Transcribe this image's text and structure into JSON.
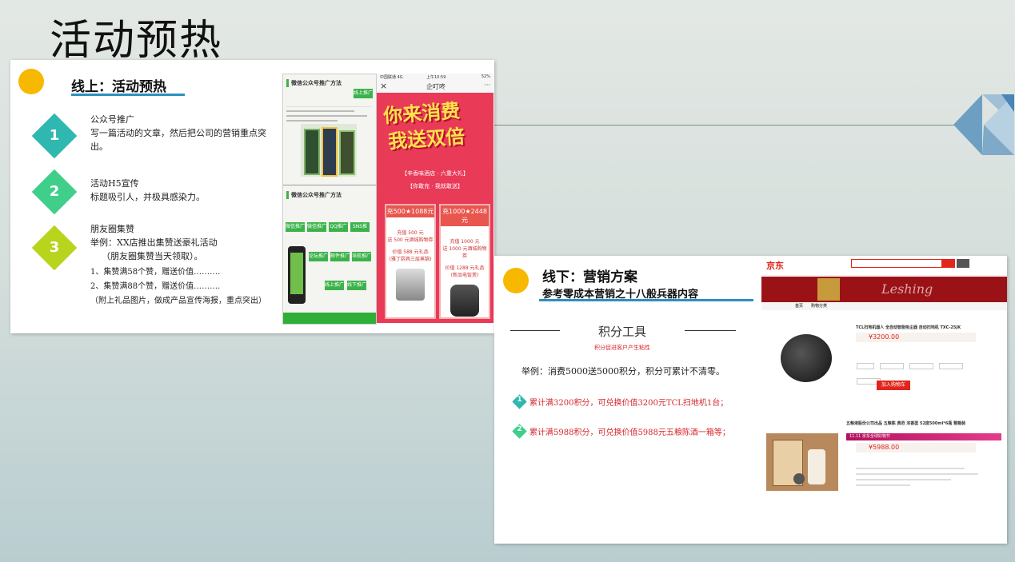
{
  "page": {
    "title": "活动预热"
  },
  "online": {
    "section_title": "线上：活动预热",
    "items": [
      {
        "num": "1",
        "title": "公众号推广",
        "desc": "写一篇活动的文章，然后把公司的营销重点突出。"
      },
      {
        "num": "2",
        "title": "活动H5宣传",
        "desc": "标题吸引人，并极具感染力。"
      },
      {
        "num": "3",
        "title": "朋友圈集赞",
        "desc": "举例：XX店推出集赞送豪礼活动",
        "desc2": "（朋友圈集赞当天领取）。",
        "sub": [
          "1、集赞满58个赞，赠送价值……….",
          "2、集赞满88个赞，赠送价值……….",
          "（附上礼品图片，做成产品宣传海报，重点突出）"
        ]
      }
    ],
    "wechat_shot": {
      "header1": "微信公众号推广方法",
      "tag1": "线上推广",
      "header2": "微信公众号推广方法",
      "buttons": [
        "微信推广",
        "微信推广",
        "QQ推广",
        "SNS推广",
        "论坛推广",
        "邮件推广",
        "导航推广"
      ],
      "tag_online": "线上推广",
      "tag_offline": "线下推广"
    },
    "h5_shot": {
      "status": "中国联通 4G",
      "time": "上午10:59",
      "battery": "52%",
      "close": "×",
      "app_title": "企叮咚",
      "more": "···",
      "banner1": "你来消费",
      "banner2": "我送双倍",
      "subtitle": "【辛香味酒店 · 六重大礼】",
      "tagline": "【你敢充 · 我就敢送】",
      "coupon1": {
        "head": "充500★1088元",
        "l1": "充值 500 元",
        "l2": "送 500 元酒城购物券",
        "l3": "价值 588 元礼品",
        "l4": "(雅丁厨具三层蒸锅)"
      },
      "coupon2": {
        "head": "充1000★2448元",
        "l1": "充值 1000 元",
        "l2": "送 1000 元酒城购物券",
        "l3": "价值 1288 元礼品",
        "l4": "(新品电饭煲)"
      }
    }
  },
  "offline": {
    "section_title": "线下：营销方案",
    "subtitle": "参考零成本营销之十八般兵器内容",
    "tool_title": "积分工具",
    "tool_sub": "积分促进客户产生粘性",
    "example": "举例：消费5000送5000积分，积分可累计不清零。",
    "points": [
      {
        "num": "1",
        "text": "累计满3200积分，可兑换价值3200元TCL扫地机1台；"
      },
      {
        "num": "2",
        "text": "累计满5988积分，可兑换价值5988元五粮陈酒一箱等；"
      }
    ],
    "jd_shot": {
      "logo": "京东",
      "nav": [
        "首页",
        "购物分类"
      ],
      "product1": "TCL扫地机器人 全自动智能吸尘器 自动扫地机 TXC-25JK",
      "price1": "¥3200.00",
      "cart": "加入购物车",
      "product2": "五粮液股份公司出品 五粮陈 典范 浓香型 52度500ml*6瓶 整箱装",
      "promo2": "11.11 京东全球好物节",
      "price2": "¥5988.00"
    }
  },
  "colors": {
    "teal": "#2fb8b0",
    "green": "#3fcf8a",
    "lime": "#b8d41c",
    "yellow_dot": "#f7b800",
    "accent_blue": "#2e8fbf",
    "red_text": "#d8262b"
  }
}
